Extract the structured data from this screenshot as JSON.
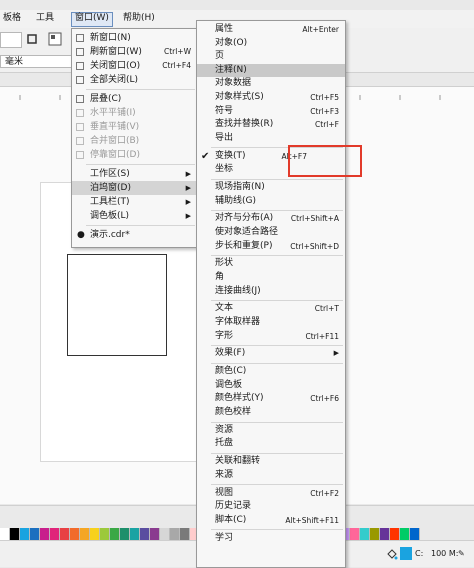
{
  "menubar": {
    "items": [
      "排格(",
      ")",
      "工具(",
      "窗口(W)",
      "帮助(H)"
    ],
    "layout_label": "板格",
    "tools_label": "工具",
    "window_label": "窗口(W)",
    "help_label": "帮助(H)"
  },
  "propbar": {
    "unit": "毫米"
  },
  "window_menu": {
    "items": [
      {
        "label": "新窗口(N)",
        "shortcut": "",
        "state": "normal"
      },
      {
        "label": "刷新窗口(W)",
        "shortcut": "Ctrl+W",
        "state": "normal"
      },
      {
        "label": "关闭窗口(O)",
        "shortcut": "Ctrl+F4",
        "state": "normal"
      },
      {
        "label": "全部关闭(L)",
        "shortcut": "",
        "state": "normal"
      },
      {
        "label": "层叠(C)",
        "shortcut": "",
        "state": "normal"
      },
      {
        "label": "水平平铺(I)",
        "shortcut": "",
        "state": "disabled"
      },
      {
        "label": "垂直平铺(V)",
        "shortcut": "",
        "state": "disabled"
      },
      {
        "label": "合并窗口(B)",
        "shortcut": "",
        "state": "disabled"
      },
      {
        "label": "停靠窗口(D)",
        "shortcut": "",
        "state": "disabled"
      },
      {
        "label": "工作区(S)",
        "shortcut": "",
        "state": "submenu"
      },
      {
        "label": "泊坞窗(D)",
        "shortcut": "",
        "state": "submenu-active"
      },
      {
        "label": "工具栏(T)",
        "shortcut": "",
        "state": "submenu"
      },
      {
        "label": "调色板(L)",
        "shortcut": "",
        "state": "submenu"
      },
      {
        "label": "演示.cdr*",
        "shortcut": "",
        "state": "current"
      }
    ]
  },
  "docker_menu": {
    "items": [
      {
        "label": "属性",
        "shortcut": "Alt+Enter"
      },
      {
        "label": "对象(O)",
        "shortcut": ""
      },
      {
        "label": "页",
        "shortcut": ""
      },
      {
        "label": "注释(N)",
        "shortcut": ""
      },
      {
        "label": "对象数据",
        "shortcut": ""
      },
      {
        "label": "对象样式(S)",
        "shortcut": "Ctrl+F5"
      },
      {
        "label": "符号",
        "shortcut": "Ctrl+F3"
      },
      {
        "label": "查找并替换(R)",
        "shortcut": "Ctrl+F"
      },
      {
        "label": "导出",
        "shortcut": ""
      },
      {
        "label": "变换(T)",
        "shortcut": "Alt+F7"
      },
      {
        "label": "坐标",
        "shortcut": ""
      },
      {
        "label": "现场指南(N)",
        "shortcut": ""
      },
      {
        "label": "辅助线(G)",
        "shortcut": ""
      },
      {
        "label": "对齐与分布(A)",
        "shortcut": "Ctrl+Shift+A"
      },
      {
        "label": "使对象适合路径",
        "shortcut": ""
      },
      {
        "label": "步长和重复(P)",
        "shortcut": "Ctrl+Shift+D"
      },
      {
        "label": "形状",
        "shortcut": ""
      },
      {
        "label": "角",
        "shortcut": ""
      },
      {
        "label": "连接曲线(J)",
        "shortcut": ""
      },
      {
        "label": "文本",
        "shortcut": "Ctrl+T"
      },
      {
        "label": "字体取样器",
        "shortcut": ""
      },
      {
        "label": "字形",
        "shortcut": "Ctrl+F11"
      },
      {
        "label": "效果(F)",
        "shortcut": ""
      },
      {
        "label": "颜色(C)",
        "shortcut": ""
      },
      {
        "label": "调色板",
        "shortcut": ""
      },
      {
        "label": "颜色样式(Y)",
        "shortcut": "Ctrl+F6"
      },
      {
        "label": "颜色校样",
        "shortcut": ""
      },
      {
        "label": "资源",
        "shortcut": ""
      },
      {
        "label": "托盘",
        "shortcut": ""
      },
      {
        "label": "关联和翻转",
        "shortcut": ""
      },
      {
        "label": "来源",
        "shortcut": ""
      },
      {
        "label": "视图",
        "shortcut": "Ctrl+F2"
      },
      {
        "label": "历史记录",
        "shortcut": ""
      },
      {
        "label": "脚本(C)",
        "shortcut": "Alt+Shift+F11"
      },
      {
        "label": "学习",
        "shortcut": ""
      }
    ]
  },
  "status": {
    "fill_label": "C:",
    "outline_label": "100 M:",
    "extra": "C:"
  },
  "colors": {
    "accent_highlight": "#e23a2a",
    "palette": [
      "#ffffff",
      "#000000",
      "#19a3e0",
      "#1b6fbf",
      "#c81f8c",
      "#e0247a",
      "#e84043",
      "#f26b2a",
      "#f5a623",
      "#f7d11c",
      "#9cc93b",
      "#3aa845",
      "#1d8f6b",
      "#1aa3a3",
      "#5a4da0",
      "#8a3b8f",
      "#d6d6d6",
      "#a8a8a8",
      "#7a7a7a",
      "#ffcccc",
      "#ffe0b3",
      "#fff2b3",
      "#d6f0c2",
      "#c2e6f0",
      "#d9c9f0",
      "#f0c9e0",
      "#b38a5c",
      "#6b4a2b",
      "#c0a060",
      "#e6d2a8",
      "#ff9999",
      "#99ccff",
      "#66cc99",
      "#ffcc66",
      "#cc99ff",
      "#ff6699",
      "#33cccc",
      "#999900",
      "#663399",
      "#ff3300",
      "#00cc66",
      "#0066cc"
    ]
  }
}
